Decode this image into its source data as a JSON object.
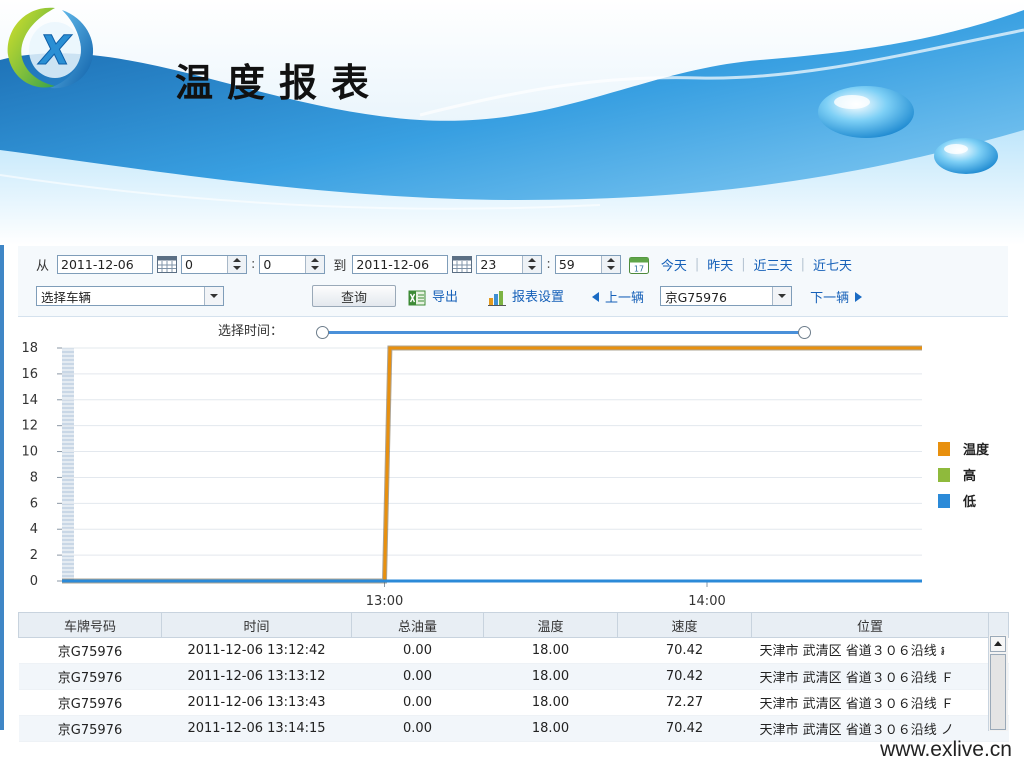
{
  "app": {
    "title": "温度报表",
    "logo_letter": "X"
  },
  "toolbar": {
    "from_label": "从",
    "from_date": "2011-12-06",
    "from_hour": "0",
    "from_minute": "0",
    "to_label": "到",
    "to_date": "2011-12-06",
    "to_hour": "23",
    "to_minute": "59",
    "quick_ranges": [
      "今天",
      "昨天",
      "近三天",
      "近七天"
    ],
    "vehicle_select_placeholder": "选择车辆",
    "query_button": "查询",
    "export_button": "导出",
    "settings_button": "报表设置",
    "prev_vehicle": "上一辆",
    "current_vehicle": "京G75976",
    "next_vehicle": "下一辆",
    "calendar_day": "17"
  },
  "slider": {
    "label": "选择时间：",
    "start": 0.0,
    "end": 1.0
  },
  "chart_data": {
    "type": "line",
    "x_tick_labels": [
      "13:00",
      "14:00"
    ],
    "ylim": [
      0,
      18
    ],
    "y_ticks": [
      0,
      2,
      4,
      6,
      8,
      10,
      12,
      14,
      16,
      18
    ],
    "grid": true,
    "legend_position": "right",
    "series": [
      {
        "name": "温度",
        "color": "#e8900e",
        "points": [
          [
            "12:00",
            0
          ],
          [
            "13:00",
            0
          ],
          [
            "13:01",
            18
          ],
          [
            "14:40",
            18
          ]
        ]
      },
      {
        "name": "高",
        "color": "#8fba3c",
        "points": []
      },
      {
        "name": "低",
        "color": "#2b8ad8",
        "points": [
          [
            "12:00",
            0
          ],
          [
            "14:40",
            0
          ]
        ]
      }
    ]
  },
  "table": {
    "columns": [
      "车牌号码",
      "时间",
      "总油量",
      "温度",
      "速度",
      "位置"
    ],
    "rows": [
      [
        "京G75976",
        "2011-12-06 13:12:42",
        "0.00",
        "18.00",
        "70.42",
        "天津市 武清区 省道３０６沿线 ៛"
      ],
      [
        "京G75976",
        "2011-12-06 13:13:12",
        "0.00",
        "18.00",
        "70.42",
        "天津市 武清区 省道３０６沿线 Ｆ"
      ],
      [
        "京G75976",
        "2011-12-06 13:13:43",
        "0.00",
        "18.00",
        "72.27",
        "天津市 武清区 省道３０６沿线 Ｆ"
      ],
      [
        "京G75976",
        "2011-12-06 13:14:15",
        "0.00",
        "18.00",
        "70.42",
        "天津市 武清区 省道３０６沿线 ノ"
      ]
    ]
  },
  "footer": {
    "url": "www.exlive.cn"
  },
  "colors": {
    "accent": "#1560b8",
    "temperature": "#e8900e",
    "high": "#8fba3c",
    "low": "#2b8ad8"
  }
}
